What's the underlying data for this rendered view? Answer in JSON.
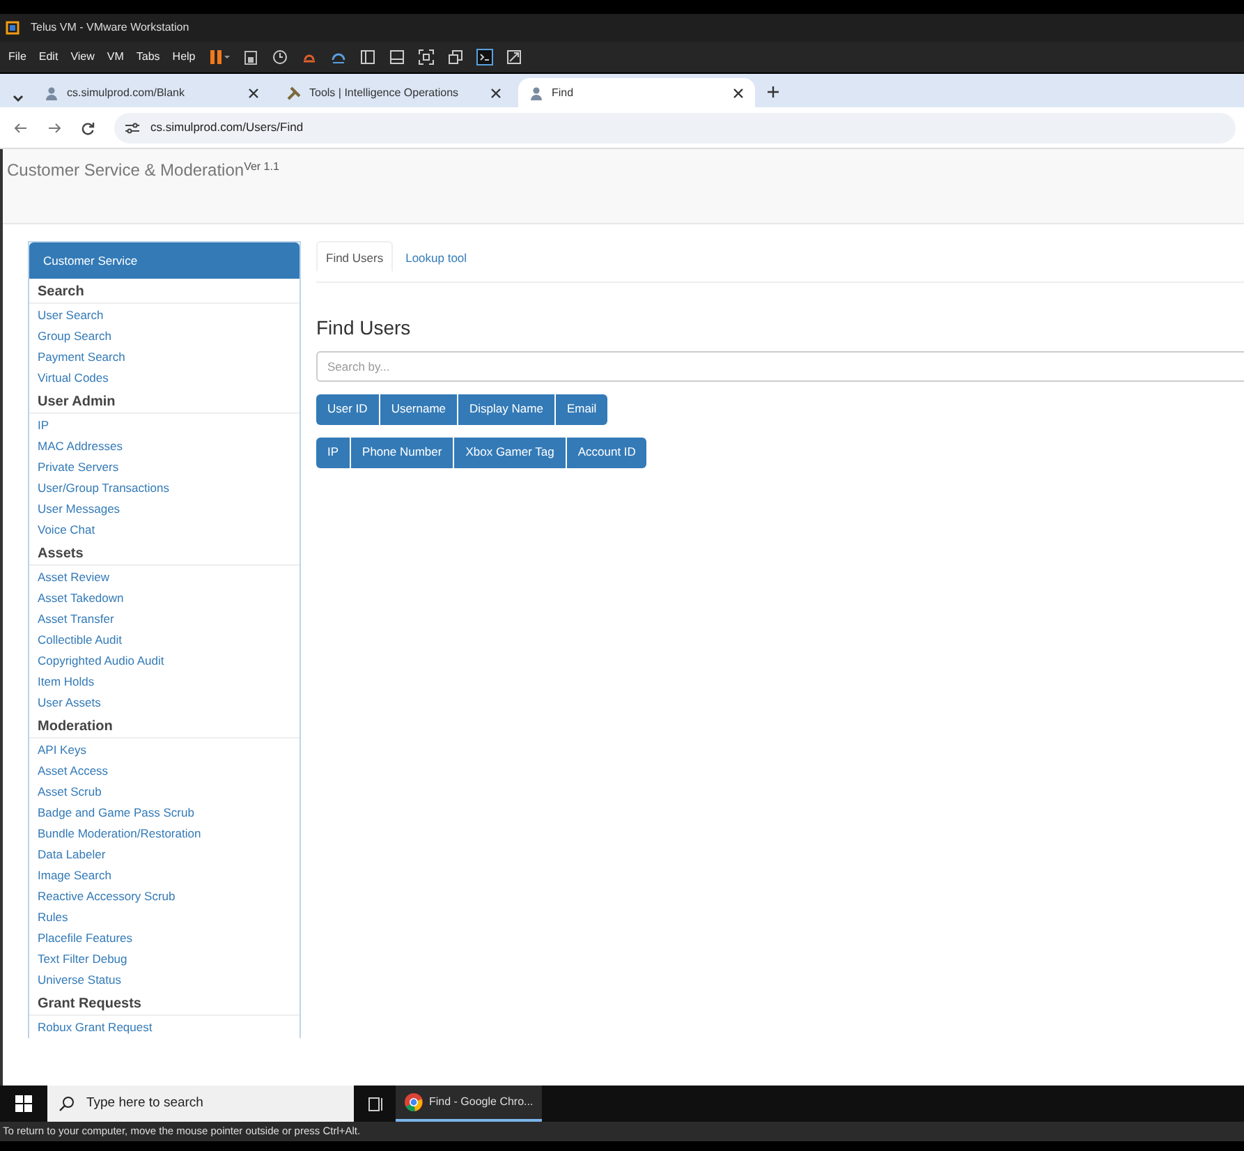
{
  "vm_window": {
    "title": "Telus VM - VMware Workstation",
    "menu": [
      "File",
      "Edit",
      "View",
      "VM",
      "Tabs",
      "Help"
    ]
  },
  "browser": {
    "tabs": [
      {
        "title": "cs.simulprod.com/Blank",
        "selected": false
      },
      {
        "title": "Tools | Intelligence Operations",
        "selected": false
      },
      {
        "title": "Find",
        "selected": true
      }
    ],
    "address": "cs.simulprod.com/Users/Find"
  },
  "page": {
    "app_title": "Customer Service & Moderation",
    "version": "Ver 1.1",
    "sidebar": {
      "header": "Customer Service",
      "sections": [
        {
          "title": "Search",
          "items": [
            "User Search",
            "Group Search",
            "Payment Search",
            "Virtual Codes"
          ]
        },
        {
          "title": "User Admin",
          "items": [
            "IP",
            "MAC Addresses",
            "Private Servers",
            "User/Group Transactions",
            "User Messages",
            "Voice Chat"
          ]
        },
        {
          "title": "Assets",
          "items": [
            "Asset Review",
            "Asset Takedown",
            "Asset Transfer",
            "Collectible Audit",
            "Copyrighted Audio Audit",
            "Item Holds",
            "User Assets"
          ]
        },
        {
          "title": "Moderation",
          "items": [
            "API Keys",
            "Asset Access",
            "Asset Scrub",
            "Badge and Game Pass Scrub",
            "Bundle Moderation/Restoration",
            "Data Labeler",
            "Image Search",
            "Reactive Accessory Scrub",
            "Rules",
            "Placefile Features",
            "Text Filter Debug",
            "Universe Status"
          ]
        },
        {
          "title": "Grant Requests",
          "items": [
            "Robux Grant Request"
          ]
        }
      ]
    },
    "tabs": [
      {
        "label": "Find Users",
        "selected": true
      },
      {
        "label": "Lookup tool",
        "selected": false
      }
    ],
    "heading": "Find Users",
    "search": {
      "placeholder": "Search by..."
    },
    "button_rows": [
      [
        "User ID",
        "Username",
        "Display Name",
        "Email"
      ],
      [
        "IP",
        "Phone Number",
        "Xbox Gamer Tag",
        "Account ID"
      ]
    ]
  },
  "taskbar": {
    "search_placeholder": "Type here to search",
    "task": "Find - Google Chro..."
  },
  "status_bar": "To return to your computer, move the mouse pointer outside or press Ctrl+Alt."
}
